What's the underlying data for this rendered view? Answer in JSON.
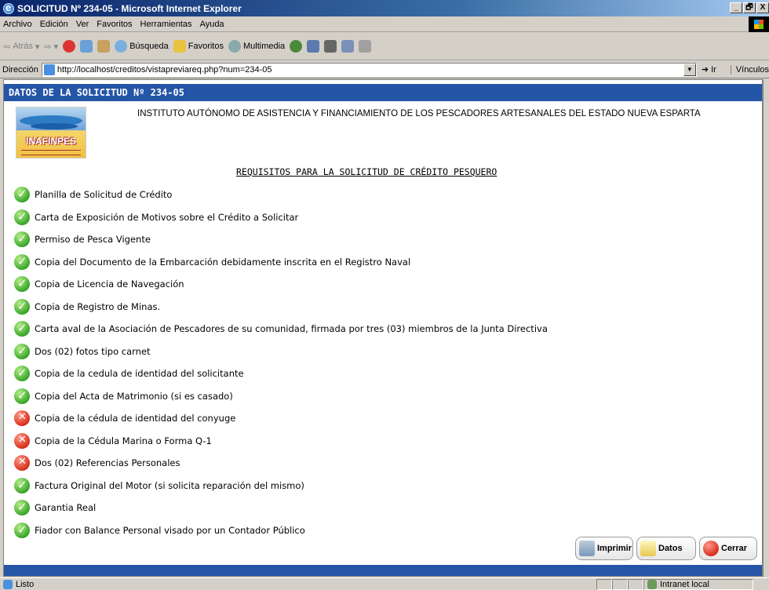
{
  "window": {
    "title": "SOLICITUD Nº 234-05 - Microsoft Internet Explorer",
    "controls": [
      "_",
      "🗗",
      "X"
    ]
  },
  "menu": [
    "Archivo",
    "Edición",
    "Ver",
    "Favoritos",
    "Herramientas",
    "Ayuda"
  ],
  "toolbar": {
    "back": "Atrás",
    "search": "Búsqueda",
    "favorites": "Favoritos",
    "multimedia": "Multimedia"
  },
  "address": {
    "label": "Dirección",
    "url": "http://localhost/creditos/vistapreviareq.php?num=234-05",
    "go": "Ir",
    "links": "Vínculos"
  },
  "page": {
    "header": "DATOS DE LA SOLICITUD Nº 234-05",
    "logo_text": "INAFINPES",
    "institute": "INSTITUTO AUTÓNOMO DE ASISTENCIA Y FINANCIAMIENTO DE LOS PESCADORES ARTESANALES DEL ESTADO NUEVA ESPARTA",
    "requirements_title": "REQUISITOS PARA LA SOLICITUD DE CRÉDITO PESQUERO",
    "requirements": [
      {
        "label": "Planilla de Solicitud de Crédito",
        "status": "ok"
      },
      {
        "label": "Carta de Exposición de Motivos sobre el Crédito a Solicitar",
        "status": "ok"
      },
      {
        "label": "Permiso de Pesca Vigente",
        "status": "ok"
      },
      {
        "label": "Copia del Documento de la Embarcación debidamente inscrita en el Registro Naval",
        "status": "ok"
      },
      {
        "label": "Copia de Licencia de Navegación",
        "status": "ok"
      },
      {
        "label": "Copia de Registro de Minas.",
        "status": "ok"
      },
      {
        "label": "Carta aval de la Asociación de Pescadores de su comunidad, firmada por tres (03) miembros de la Junta Directiva",
        "status": "ok"
      },
      {
        "label": "Dos (02) fotos tipo carnet",
        "status": "ok"
      },
      {
        "label": "Copia de la cedula de identidad del solicitante",
        "status": "ok"
      },
      {
        "label": "Copia del Acta de Matrimonio (si es casado)",
        "status": "ok"
      },
      {
        "label": "Copia de la cédula de identidad del conyuge",
        "status": "no"
      },
      {
        "label": "Copia de la Cédula Marina o Forma Q-1",
        "status": "no"
      },
      {
        "label": "Dos (02) Referencias Personales",
        "status": "no"
      },
      {
        "label": "Factura Original del Motor (si solicita reparación del mismo)",
        "status": "ok"
      },
      {
        "label": "Garantia Real",
        "status": "ok"
      },
      {
        "label": "Fiador con Balance Personal visado por un Contador Público",
        "status": "ok"
      }
    ],
    "buttons": {
      "print": "Imprimir",
      "data": "Datos",
      "close": "Cerrar"
    }
  },
  "status": {
    "left": "Listo",
    "zone": "Intranet local"
  }
}
